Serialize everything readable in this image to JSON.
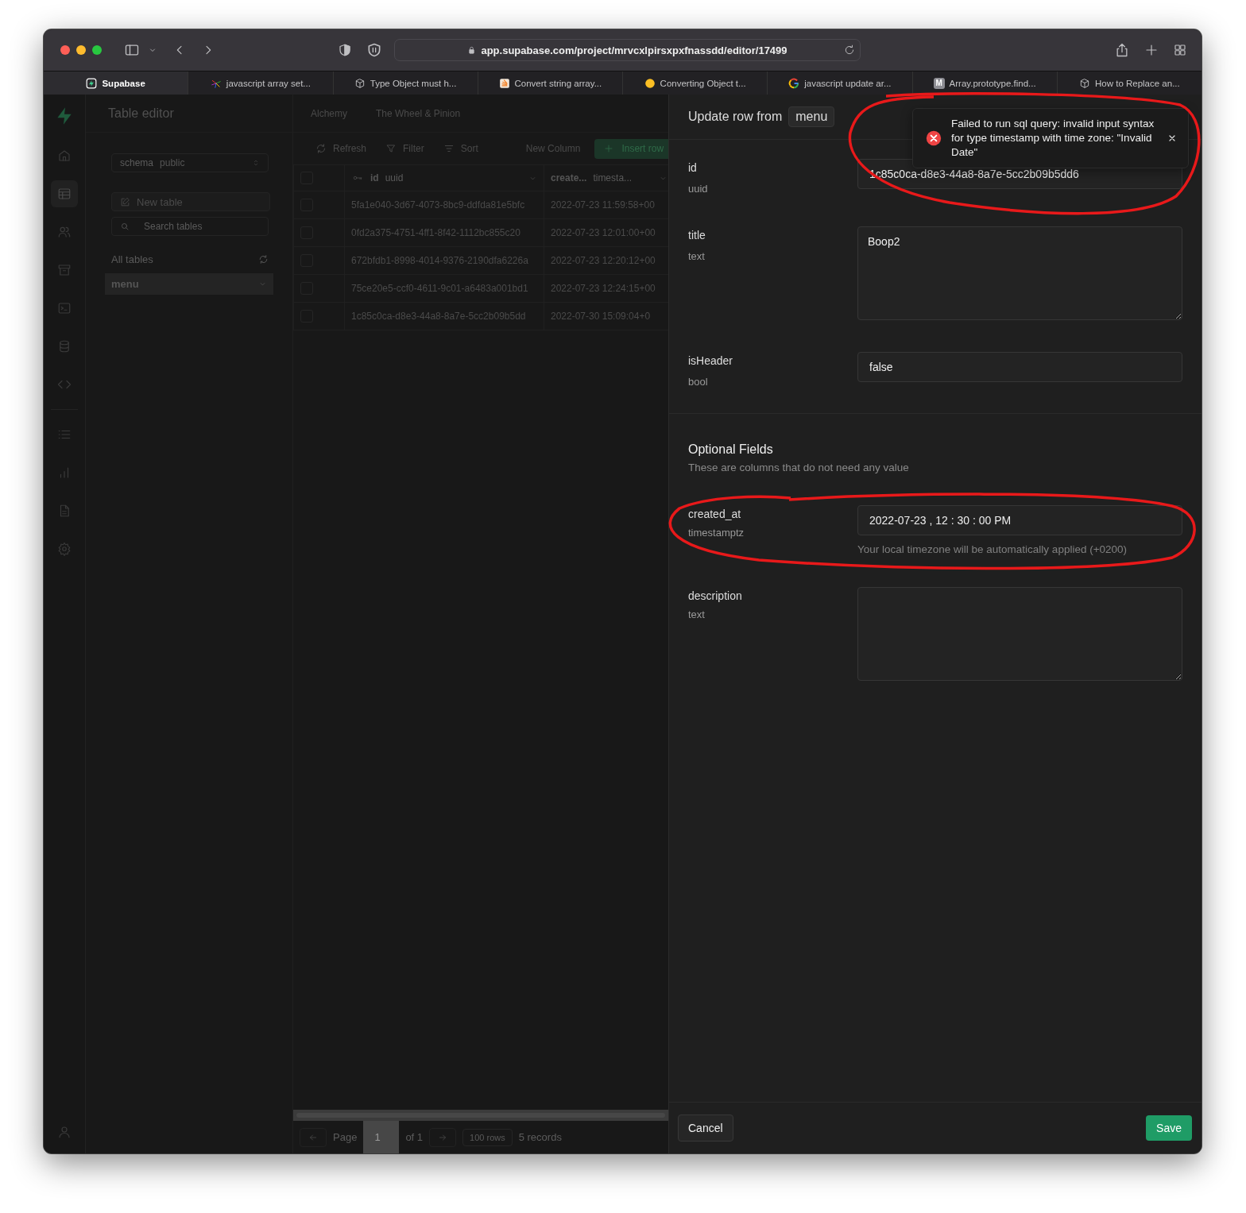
{
  "browser": {
    "url": "app.supabase.com/project/mrvcxlpirsxpxfnassdd/editor/17499",
    "tabs": [
      {
        "title": "Supabase",
        "kind": "supabase",
        "selected": true
      },
      {
        "title": "javascript array set...",
        "kind": "pinwheel",
        "selected": false
      },
      {
        "title": "Type Object must h...",
        "kind": "cube",
        "selected": false
      },
      {
        "title": "Convert string array...",
        "kind": "stack",
        "selected": false
      },
      {
        "title": "Converting Object t...",
        "kind": "dot",
        "selected": false
      },
      {
        "title": "javascript update ar...",
        "kind": "google",
        "selected": false
      },
      {
        "title": "Array.prototype.find...",
        "kind": "letter",
        "letter": "M",
        "selected": false
      },
      {
        "title": "How to Replace an...",
        "kind": "cube",
        "selected": false
      }
    ]
  },
  "nav": [
    {
      "kind": "home",
      "selected": false
    },
    {
      "kind": "table",
      "selected": true
    },
    {
      "kind": "users",
      "selected": false
    },
    {
      "kind": "archive",
      "selected": false
    },
    {
      "kind": "terminal",
      "selected": false
    },
    {
      "kind": "database",
      "selected": false
    },
    {
      "kind": "code",
      "selected": false
    },
    {
      "kind": "list",
      "selected": false
    },
    {
      "kind": "chart",
      "selected": false
    },
    {
      "kind": "document",
      "selected": false
    },
    {
      "kind": "settings",
      "selected": false
    }
  ],
  "sidebar": {
    "title": "Table editor",
    "schema_label": "schema",
    "schema_value": "public",
    "new_table": "New table",
    "search_placeholder": "Search tables",
    "section": "All tables",
    "tables": [
      {
        "name": "menu",
        "selected": true
      }
    ]
  },
  "breadcrumb": [
    "Alchemy",
    "The Wheel & Pinion"
  ],
  "toolbar": {
    "refresh": "Refresh",
    "filter": "Filter",
    "sort": "Sort",
    "new_column": "New Column",
    "insert_row": "Insert row"
  },
  "table": {
    "header_checked": false,
    "columns": [
      {
        "name": "id",
        "type": "uuid",
        "primary_key": true
      },
      {
        "name": "create...",
        "type": "timesta...",
        "primary_key": false
      }
    ],
    "rows": [
      {
        "checked": false,
        "cells": [
          "5fa1e040-3d67-4073-8bc9-ddfda81e5bfc",
          "2022-07-23 11:59:58+00"
        ]
      },
      {
        "checked": false,
        "cells": [
          "0fd2a375-4751-4ff1-8f42-1112bc855c20",
          "2022-07-23 12:01:00+00"
        ]
      },
      {
        "checked": false,
        "cells": [
          "672bfdb1-8998-4014-9376-2190dfa6226a",
          "2022-07-23 12:20:12+00"
        ]
      },
      {
        "checked": false,
        "cells": [
          "75ce20e5-ccf0-4611-9c01-a6483a001bd1",
          "2022-07-23 12:24:15+00"
        ]
      },
      {
        "checked": false,
        "cells": [
          "1c85c0ca-d8e3-44a8-8a7e-5cc2b09b5dd",
          "2022-07-30 15:09:04+0"
        ]
      }
    ]
  },
  "pagination": {
    "page_label": "Page",
    "page_value": "1",
    "of": "of 1",
    "rows": "100 rows",
    "records": "5 records"
  },
  "editor": {
    "title": "Update row from",
    "table": "menu",
    "fields": [
      {
        "name": "id",
        "type": "uuid",
        "kind": "input",
        "value": "1c85c0ca-d8e3-44a8-8a7e-5cc2b09b5dd6"
      },
      {
        "name": "title",
        "type": "text",
        "kind": "textarea",
        "value": "Boop2"
      },
      {
        "name": "isHeader",
        "type": "bool",
        "kind": "input",
        "value": "false"
      }
    ],
    "optional_title": "Optional Fields",
    "optional_subtitle": "These are columns that do not need any value",
    "optional_fields": [
      {
        "name": "created_at",
        "type": "timestamptz",
        "kind": "input",
        "value": "2022-07-23 , 12 : 30 : 00 PM",
        "hint": "Your local timezone will be automatically applied (+0200)"
      },
      {
        "name": "description",
        "type": "text",
        "kind": "textarea"
      }
    ],
    "cancel": "Cancel",
    "save": "Save"
  },
  "toast": {
    "message": "Failed to run sql query: invalid input syntax for type timestamp with time zone: \"Invalid Date\""
  }
}
